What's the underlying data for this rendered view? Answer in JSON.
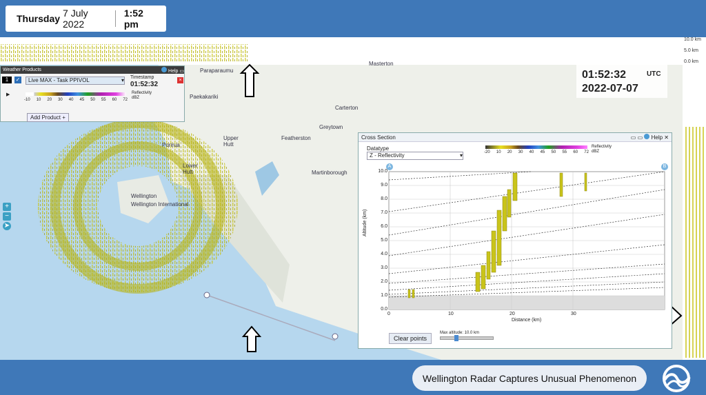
{
  "header": {
    "day": "Thursday",
    "date": "7 July 2022",
    "time": "1:52 pm"
  },
  "caption": "Wellington Radar Captures Unusual Phenomenon",
  "right_scale": [
    "10.0 km",
    "5.0 km",
    "0.0 km"
  ],
  "timestamp_overlay": {
    "time": "01:52:32",
    "zone": "UTC",
    "date": "2022-07-07"
  },
  "weather_panel": {
    "title": "Weather Products",
    "help": "Help",
    "row_num": "1",
    "product": "Live MAX - Task PPIVOL",
    "ts_label": "Timestamp",
    "ts_value": "01:52:32",
    "scale": [
      "-10",
      "10",
      "20",
      "30",
      "40",
      "45",
      "50",
      "55",
      "60",
      "72"
    ],
    "unit": "Reflectivity dBZ",
    "add_button": "Add Product +"
  },
  "places": [
    "Paraparaumu",
    "Paekakariki",
    "Masterton",
    "Carterton",
    "Greytown",
    "Featherston",
    "Upper Hutt",
    "Porirua",
    "Lower Hutt",
    "Wellington",
    "Wellington International",
    "Martinborough"
  ],
  "cross_section": {
    "title": "Cross Section",
    "help": "Help",
    "datatype_label": "Datatype",
    "datatype_value": "Z - Reflectivity",
    "scale": [
      "-20",
      "10",
      "20",
      "30",
      "40",
      "45",
      "50",
      "55",
      "60",
      "72"
    ],
    "unit": "Reflectivity dBZ",
    "ylabel": "Altitude (km)",
    "xlabel": "Distance (km)",
    "yticks": [
      "10.0",
      "9.0",
      "8.0",
      "7.0",
      "6.0",
      "5.0",
      "4.0",
      "3.0",
      "2.0",
      "1.0",
      "0.0"
    ],
    "xticks": [
      "0",
      "10",
      "20",
      "30"
    ],
    "point_a": "A",
    "point_b": "B",
    "clear_button": "Clear points",
    "max_alt": "Max altitude: 10.0 km"
  },
  "colors": {
    "brand": "#3f78b8",
    "radar": "#c9c41a",
    "water": "#b6d7ee",
    "land": "#eef0ea"
  }
}
